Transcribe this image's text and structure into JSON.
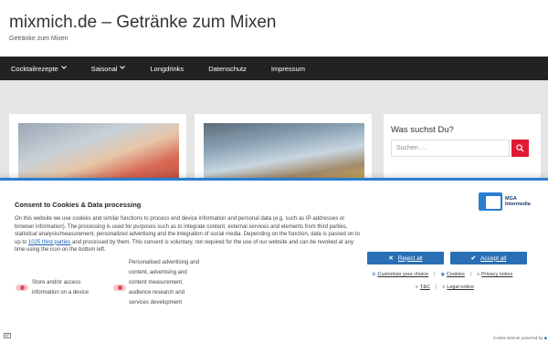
{
  "header": {
    "title": "mixmich.de – Getränke zum Mixen",
    "tagline": "Getränke zum Mixen"
  },
  "nav": {
    "items": [
      {
        "label": "Cocktailrezepte",
        "has_dropdown": true
      },
      {
        "label": "Saisonal",
        "has_dropdown": true
      },
      {
        "label": "Longdrinks",
        "has_dropdown": false
      },
      {
        "label": "Datenschutz",
        "has_dropdown": false
      },
      {
        "label": "Impressum",
        "has_dropdown": false
      }
    ],
    "chevron": "⌄"
  },
  "sidebar": {
    "search_title": "Was suchst Du?",
    "search_placeholder": "Suchen …",
    "search_icon": "search-icon"
  },
  "cookie": {
    "title": "Consent to Cookies & Data processing",
    "text_before_link": "On this website we use cookies and similar functions to process end device information and personal data (e.g. such as IP-addresses or browser information). The processing is used for purposes such as to integrate content, external services and elements from third parties, statistical analysis/measurement, personalized advertising and the integration of social media. Depending on the function, data is passed on to up to ",
    "link_text": "1025 third parties",
    "text_after_link": " and processed by them. This consent is voluntary, not required for the use of our website and can be revoked at any time using the icon on the bottom left.",
    "logo_line1": "MGA",
    "logo_line2": "Intermedia",
    "purpose1": "Store and/or access information on a device",
    "purpose2": "Personalised advertising and content, advertising and content measurement, audience research and services development",
    "reject_label": "Reject all",
    "accept_label": "Accept all",
    "links": {
      "customize": "Customize your choice",
      "cookies": "Cookies",
      "privacy": "Privacy notice",
      "tc": "T&C",
      "legal": "Legal notice"
    },
    "powered_by": "Cookie Banner powered by",
    "accent_color": "#2a6fb5"
  }
}
